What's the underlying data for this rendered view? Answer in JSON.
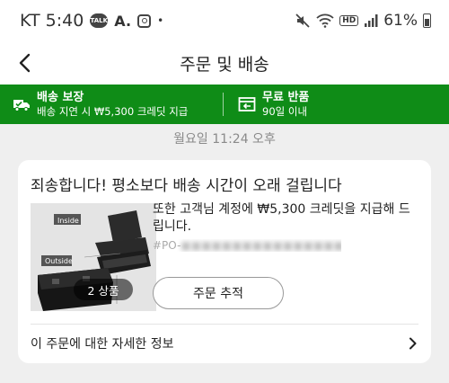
{
  "status_bar": {
    "carrier_time": "KT 5:40",
    "talk_badge": "TALK",
    "a_glyph": "A.",
    "dot": "•",
    "battery": "61%",
    "hd": "HD"
  },
  "header": {
    "title": "주문 및 배송"
  },
  "banner": {
    "delivery_title": "배송 보장",
    "delivery_sub": "배송 지연 시 ₩5,300 크레딧 지급",
    "return_title": "무료 반품",
    "return_sub": "90일 이내",
    "background": "#0f8c17"
  },
  "order": {
    "date": "월요일 11:24 오후",
    "title": "죄송합니다! 평소보다 배송 시간이 오래 걸립니다",
    "message": "또한 고객님 계정에 ₩5,300 크레딧을 지급해 드립니다.",
    "order_no_prefix": "#PO-",
    "image_label_inside": "Inside",
    "image_label_outside": "Outside",
    "item_count": "2 상품",
    "track_label": "주문 추적",
    "details_label": "이 주문에 대한 자세한 정보"
  },
  "icons": [
    "back-arrow-icon",
    "truck-shield-icon",
    "return-box-icon",
    "chevron-right-icon",
    "mute-icon",
    "wifi-icon",
    "signal-icon",
    "battery-icon",
    "instagram-icon"
  ]
}
